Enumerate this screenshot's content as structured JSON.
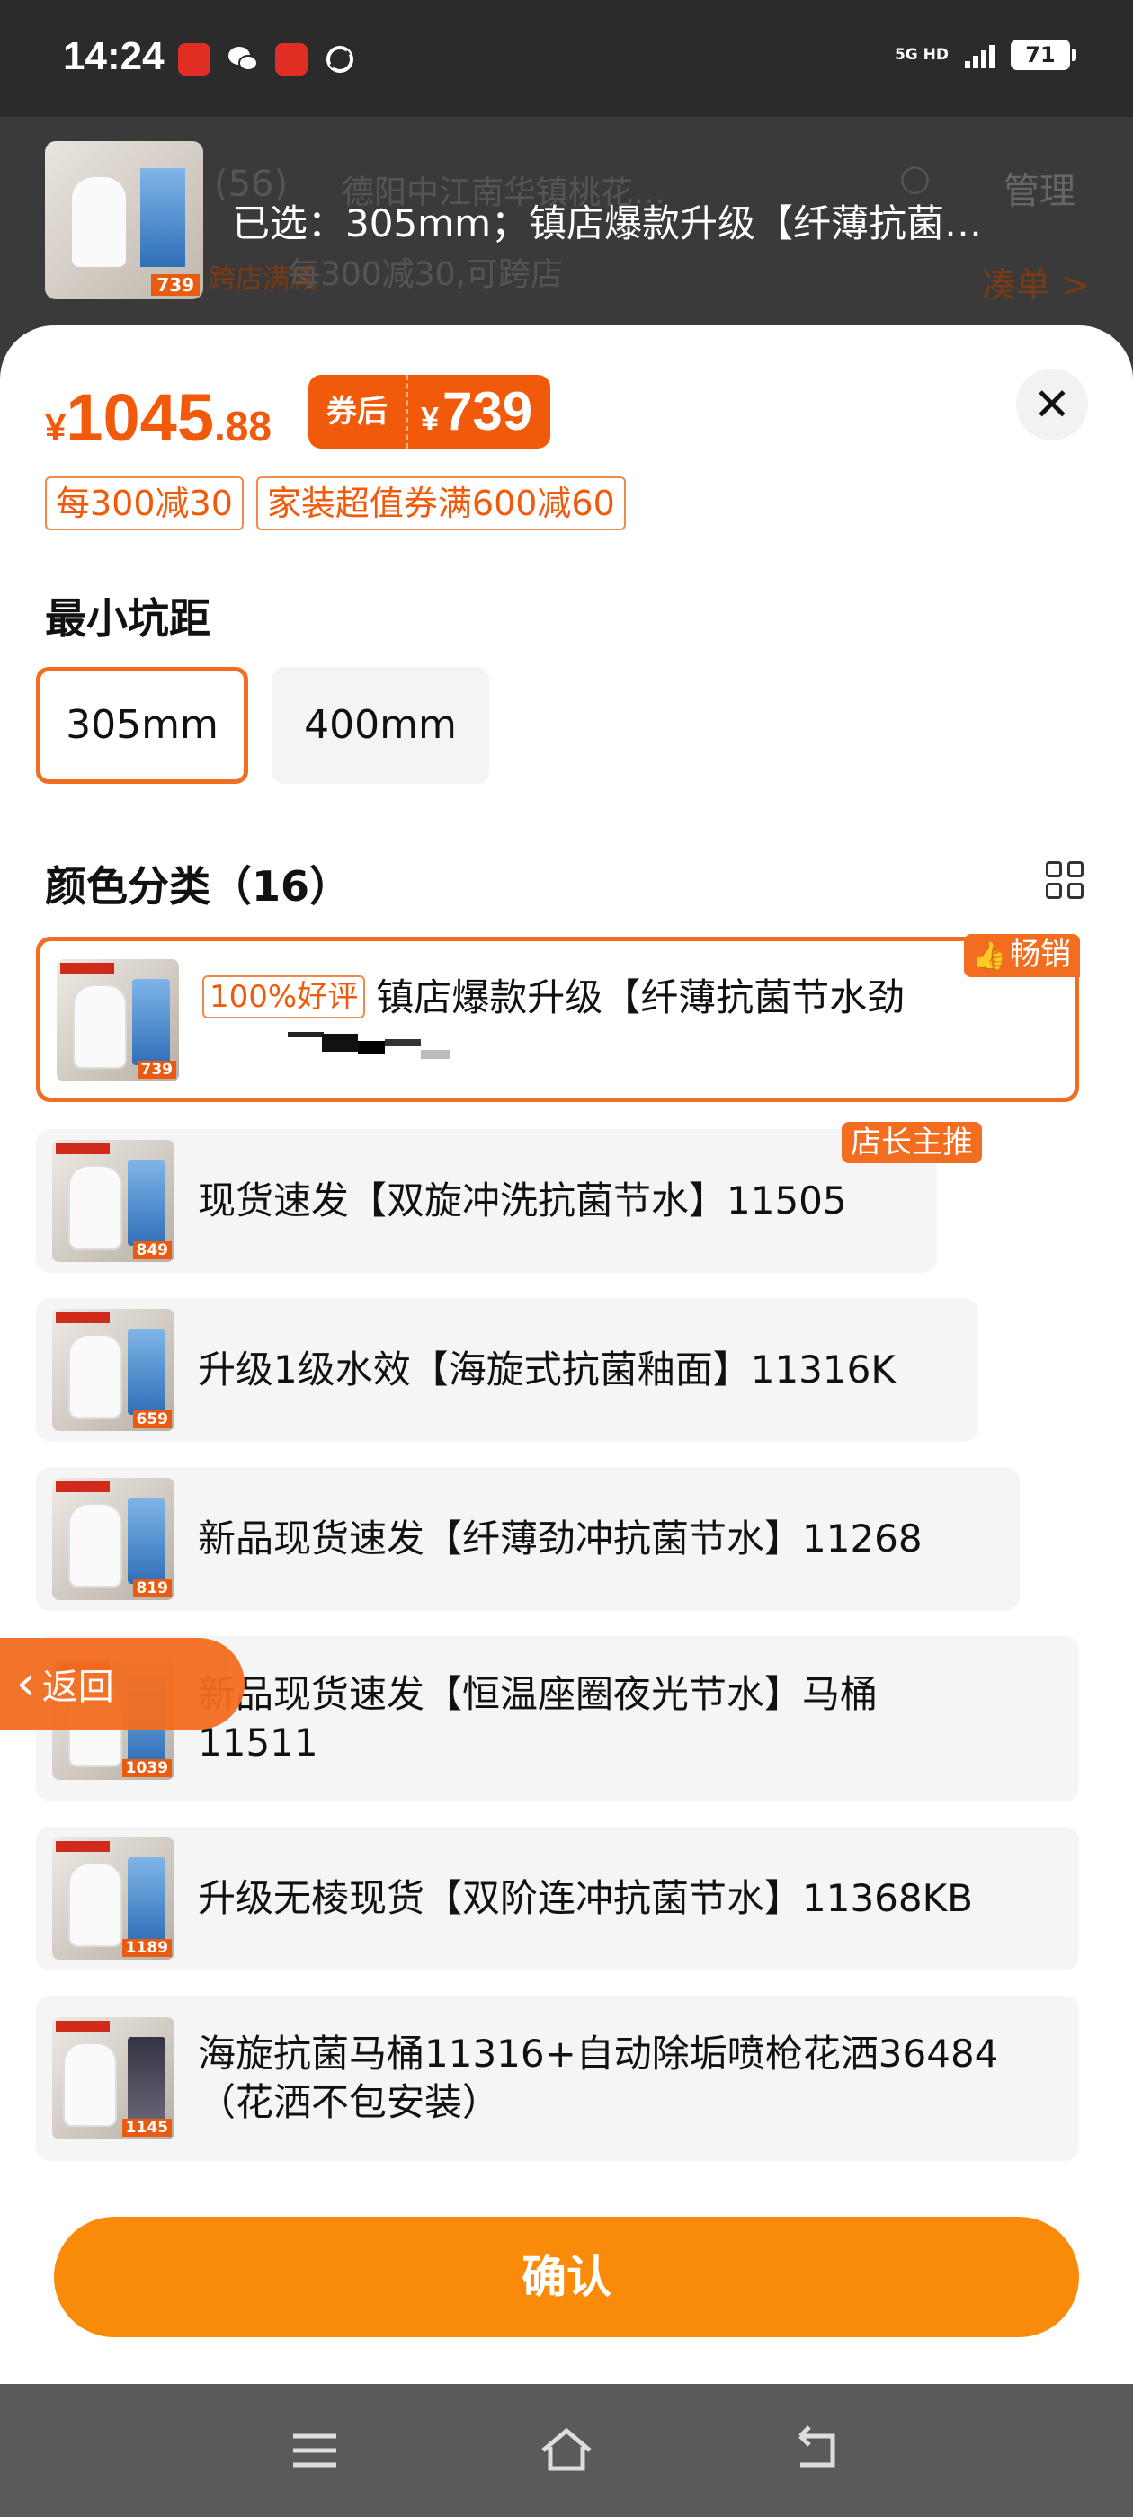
{
  "status_bar": {
    "time": "14:24",
    "network": "5G HD",
    "battery": "71",
    "app_icons": [
      "pinduoduo-icon",
      "wechat-icon",
      "pinduoduo618-icon",
      "sync-app-icon"
    ]
  },
  "background_page": {
    "header_fragment": "E (56)",
    "location": "德阳中江南华镇桃花…",
    "manage_label": "管理",
    "promo_tag": "跨店满减",
    "promo_text": "每300减30,可跨店",
    "gather_link": "凑单 >",
    "thumb_price": "739"
  },
  "selection": {
    "selected_text": "已选：305mm；镇店爆款升级【纤薄抗菌…"
  },
  "price": {
    "currency": "¥",
    "integer": "1045",
    "decimal": ".88",
    "coupon_label": "券后",
    "coupon_currency": "¥",
    "coupon_value": "739"
  },
  "promos": [
    "每300减30",
    "家装超值券满600减60"
  ],
  "size_section": {
    "title": "最小坑距",
    "options": [
      "305mm",
      "400mm"
    ],
    "selected": "305mm"
  },
  "color_section": {
    "title": "颜色分类（16）",
    "variants": [
      {
        "badge": "100%好评",
        "name": "镇店爆款升级【纤薄抗菌节水劲",
        "thumb_price": "739",
        "tag": "畅销",
        "selected": true
      },
      {
        "name": "现货速发【双旋冲洗抗菌节水】11505",
        "thumb_price": "849",
        "tag": "店长主推"
      },
      {
        "name": "升级1级水效【海旋式抗菌釉面】11316K",
        "thumb_price": "659"
      },
      {
        "name": "新品现货速发【纤薄劲冲抗菌节水】11268",
        "thumb_price": "819"
      },
      {
        "name": "新品现货速发【恒温座圈夜光节水】马桶",
        "name_line2": "11511",
        "thumb_price": "1039"
      },
      {
        "name": "升级无棱现货【双阶连冲抗菌节水】11368KB",
        "thumb_price": "1189"
      },
      {
        "name": "海旋抗菌马桶11316+自动除垢喷枪花洒36484",
        "name_line2": "（花洒不包安装）",
        "thumb_price": "1145"
      }
    ]
  },
  "back_button": "返回",
  "confirm_button": "确认",
  "colors": {
    "accent": "#f26d1f",
    "price": "#f05a0a",
    "confirm": "#fa8b0a"
  }
}
